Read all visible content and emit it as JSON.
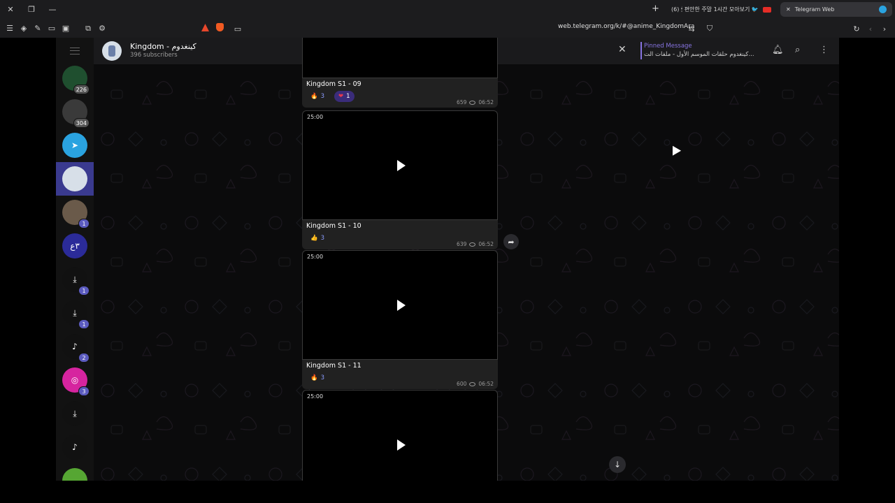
{
  "browser": {
    "tabs": [
      {
        "label": "(6) 🕯 편안한 주말 1시간 모아보기 🐦",
        "active": false
      },
      {
        "label": "Telegram Web",
        "active": true
      }
    ],
    "url": "web.telegram.org/k/#@anime_KingdomAra"
  },
  "sidebar": {
    "chats": [
      {
        "badge": "226",
        "color": "#1f4f2f",
        "glyph": ""
      },
      {
        "badge": "304",
        "color": "#3a3a3a",
        "glyph": ""
      },
      {
        "badge": "",
        "color": "#2aa3e0",
        "glyph": "➤"
      },
      {
        "badge": "",
        "color": "#d7dfe8",
        "glyph": "",
        "selected": true
      },
      {
        "badge": "1",
        "color": "#6a5a4a",
        "glyph": ""
      },
      {
        "badge": "",
        "color": "#2b2b99",
        "glyph": "٣ع"
      },
      {
        "badge": "1",
        "color": "#111111",
        "glyph": "⤓"
      },
      {
        "badge": "1",
        "color": "#111111",
        "glyph": "⤓"
      },
      {
        "badge": "2",
        "color": "#111111",
        "glyph": "♪"
      },
      {
        "badge": "3",
        "color": "#d6249f",
        "glyph": "◎"
      },
      {
        "badge": "",
        "color": "#111111",
        "glyph": "⤓"
      },
      {
        "badge": "",
        "color": "#111111",
        "glyph": "♪"
      },
      {
        "badge": "",
        "color": "#56a633",
        "glyph": ""
      }
    ]
  },
  "channel": {
    "title": "Kingdom - كينغدوم",
    "subscribers": "396 subscribers"
  },
  "pinned": {
    "title": "Pinned Message",
    "text": "كينغدوم حلقات الموسم الأول - ملفات الت..."
  },
  "messages": [
    {
      "caption": "Kingdom S1 - 09",
      "reactions": [
        {
          "emoji": "🔥",
          "count": "3"
        },
        {
          "emoji": "❤",
          "count": "1",
          "mine": true
        }
      ],
      "views": "659",
      "time": "06:52"
    },
    {
      "duration": "25:00",
      "caption": "Kingdom S1 - 10",
      "reactions": [
        {
          "emoji": "👍",
          "count": "3"
        }
      ],
      "views": "639",
      "time": "06:52"
    },
    {
      "duration": "25:00",
      "caption": "Kingdom S1 - 11",
      "reactions": [
        {
          "emoji": "🔥",
          "count": "3"
        }
      ],
      "views": "600",
      "time": "06:52"
    },
    {
      "duration": "25:00"
    }
  ]
}
